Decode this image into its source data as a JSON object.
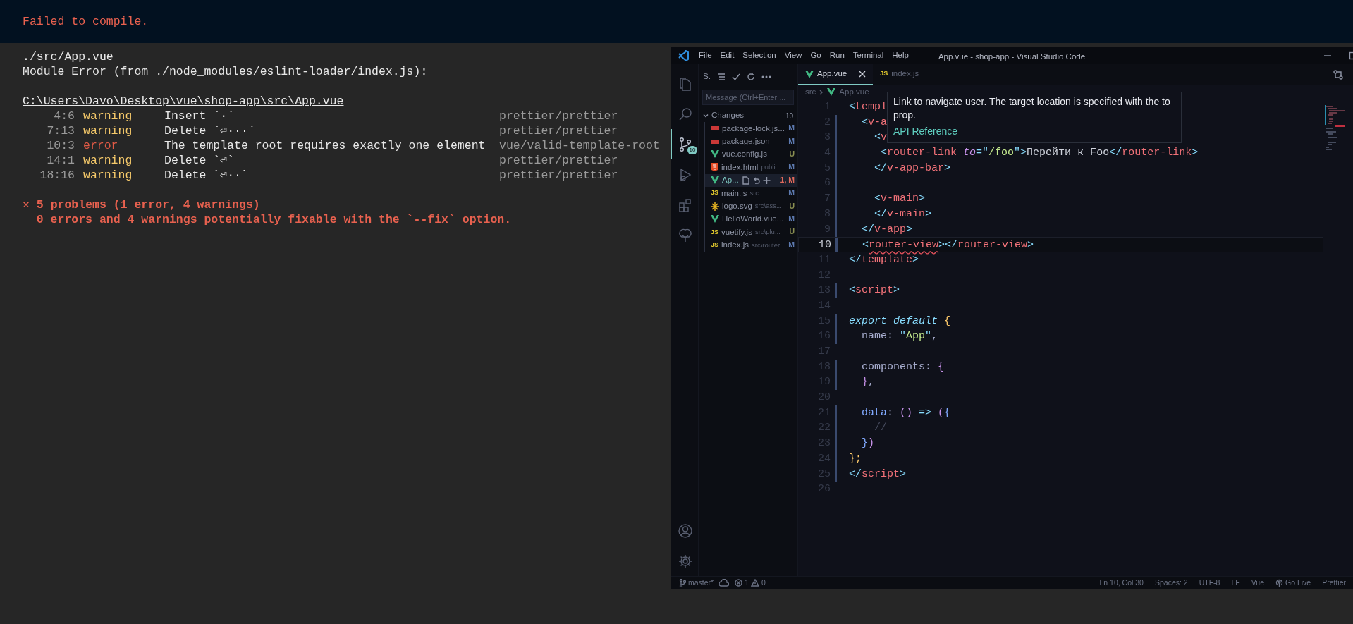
{
  "terminal": {
    "banner": "Failed to compile.",
    "file": "./src/App.vue",
    "module_error": "Module Error (from ./node_modules/eslint-loader/index.js):",
    "path": "C:\\Users\\Davo\\Desktop\\vue\\shop-app\\src\\App.vue",
    "problems": [
      {
        "location": "4:6",
        "severity": "warning",
        "kind": "warning",
        "message": "Insert `·`",
        "rule": "prettier/prettier"
      },
      {
        "location": "7:13",
        "severity": "warning",
        "kind": "warning",
        "message": "Delete `⏎···`",
        "rule": "prettier/prettier"
      },
      {
        "location": "10:3",
        "severity": "error",
        "kind": "error",
        "message": "The template root requires exactly one element",
        "rule": "vue/valid-template-root"
      },
      {
        "location": "14:1",
        "severity": "warning",
        "kind": "warning",
        "message": "Delete `⏎`",
        "rule": "prettier/prettier"
      },
      {
        "location": "18:16",
        "severity": "warning",
        "kind": "warning",
        "message": "Delete `⏎··`",
        "rule": "prettier/prettier"
      }
    ],
    "summary": "✕ 5 problems (1 error, 4 warnings)",
    "fixable": "0 errors and 4 warnings potentially fixable with the `--fix` option."
  },
  "vscode": {
    "window": {
      "title": "App.vue - shop-app - Visual Studio Code",
      "menu": [
        "File",
        "Edit",
        "Selection",
        "View",
        "Go",
        "Run",
        "Terminal",
        "Help"
      ]
    },
    "activity_bar": [
      {
        "kind": "files",
        "selected": false
      },
      {
        "kind": "search",
        "selected": false
      },
      {
        "kind": "source-control",
        "selected": true,
        "badge": "10"
      },
      {
        "kind": "run",
        "selected": false
      },
      {
        "kind": "extensions",
        "selected": false
      },
      {
        "kind": "tree",
        "selected": false
      }
    ],
    "activity_bar_bottom": [
      {
        "kind": "account"
      },
      {
        "kind": "settings"
      }
    ],
    "sidebar": {
      "title": "S.",
      "message_placeholder": "Message (Ctrl+Enter ...",
      "section": {
        "label": "Changes",
        "count": "10",
        "expanded": true
      },
      "files": [
        {
          "name": "package-lock.js...",
          "kind": "npm",
          "status": "M",
          "color": "#5d7ab0",
          "selected": false
        },
        {
          "name": "package.json",
          "kind": "npm",
          "status": "M",
          "color": "#5d7ab0",
          "selected": false
        },
        {
          "name": "vue.config.js",
          "kind": "vue",
          "status": "U",
          "color": "#8a8f52",
          "selected": false
        },
        {
          "name": "index.html",
          "path": "public",
          "kind": "html",
          "status": "M",
          "color": "#5d7ab0",
          "selected": false
        },
        {
          "name": "Ap...",
          "kind": "vue",
          "status": "1, M",
          "color": "#e0695b",
          "selected": true
        },
        {
          "name": "main.js",
          "path": "src",
          "kind": "js",
          "badge": "JS",
          "status": "M",
          "color": "#5d7ab0",
          "selected": false
        },
        {
          "name": "logo.svg",
          "path": "src\\ass...",
          "kind": "svg",
          "status": "U",
          "color": "#8a8f52",
          "selected": false
        },
        {
          "name": "HelloWorld.vue...",
          "kind": "vue",
          "status": "M",
          "color": "#5d7ab0",
          "selected": false
        },
        {
          "name": "vuetify.js",
          "path": "src\\plu...",
          "kind": "js",
          "badge": "JS",
          "status": "U",
          "color": "#8a8f52",
          "selected": false
        },
        {
          "name": "index.js",
          "path": "src\\router",
          "kind": "js",
          "badge": "JS",
          "status": "M",
          "color": "#5d7ab0",
          "selected": false
        }
      ]
    },
    "tabs": [
      {
        "label": "App.vue",
        "kind": "vue",
        "selected": true
      },
      {
        "label": "index.js",
        "kind": "js",
        "badge": "JS",
        "selected": false
      }
    ],
    "breadcrumbs": [
      {
        "label": "src",
        "kind": "none"
      },
      {
        "label": "App.vue",
        "kind": "vue"
      }
    ],
    "hover": {
      "text": "Link to navigate user. The target location is specified with the to prop.",
      "link": "API Reference"
    },
    "code": [
      {
        "number": "1",
        "modified": false,
        "current": false,
        "tokens": [
          {
            "text": "<",
            "kind": "punct"
          },
          {
            "text": "templ",
            "kind": "tag"
          }
        ]
      },
      {
        "number": "2",
        "modified": true,
        "current": false,
        "tokens": [
          {
            "text": "  <",
            "kind": "punct"
          },
          {
            "text": "v-a",
            "kind": "tag"
          }
        ]
      },
      {
        "number": "3",
        "modified": true,
        "current": false,
        "tokens": [
          {
            "text": "    <",
            "kind": "punct"
          },
          {
            "text": "v",
            "kind": "tag"
          }
        ]
      },
      {
        "number": "4",
        "modified": true,
        "current": false,
        "tokens": [
          {
            "text": "     <",
            "kind": "punct"
          },
          {
            "text": "router-link",
            "kind": "tag"
          },
          {
            "text": " to",
            "kind": "attr"
          },
          {
            "text": "=\"",
            "kind": "punct"
          },
          {
            "text": "/foo",
            "kind": "string"
          },
          {
            "text": "\">",
            "kind": "punct"
          },
          {
            "text": "Перейти к Foo",
            "kind": "text"
          },
          {
            "text": "</",
            "kind": "punct"
          },
          {
            "text": "router-link",
            "kind": "tag"
          },
          {
            "text": ">",
            "kind": "punct"
          }
        ]
      },
      {
        "number": "5",
        "modified": true,
        "current": false,
        "tokens": [
          {
            "text": "    </",
            "kind": "punct"
          },
          {
            "text": "v-app-bar",
            "kind": "tag"
          },
          {
            "text": ">",
            "kind": "punct"
          }
        ]
      },
      {
        "number": "6",
        "modified": true,
        "current": false
      },
      {
        "number": "7",
        "modified": true,
        "current": false,
        "tokens": [
          {
            "text": "    <",
            "kind": "punct"
          },
          {
            "text": "v-main",
            "kind": "tag"
          },
          {
            "text": ">",
            "kind": "punct"
          }
        ]
      },
      {
        "number": "8",
        "modified": true,
        "current": false,
        "tokens": [
          {
            "text": "    </",
            "kind": "punct"
          },
          {
            "text": "v-main",
            "kind": "tag"
          },
          {
            "text": ">",
            "kind": "punct"
          }
        ]
      },
      {
        "number": "9",
        "modified": true,
        "current": false,
        "tokens": [
          {
            "text": "  </",
            "kind": "punct"
          },
          {
            "text": "v-app",
            "kind": "tag"
          },
          {
            "text": ">",
            "kind": "punct"
          }
        ]
      },
      {
        "number": "10",
        "modified": true,
        "current": true,
        "tokens": [
          {
            "text": "  <",
            "kind": "punct"
          },
          {
            "text": "router-view",
            "kind": "tag-error"
          },
          {
            "text": "></",
            "kind": "punct"
          },
          {
            "text": "router-view",
            "kind": "tag"
          },
          {
            "text": ">",
            "kind": "punct"
          }
        ]
      },
      {
        "number": "11",
        "modified": false,
        "current": false,
        "tokens": [
          {
            "text": "</",
            "kind": "punct"
          },
          {
            "text": "template",
            "kind": "tag"
          },
          {
            "text": ">",
            "kind": "punct"
          }
        ]
      },
      {
        "number": "12",
        "modified": false,
        "current": false
      },
      {
        "number": "13",
        "modified": true,
        "current": false,
        "tokens": [
          {
            "text": "<",
            "kind": "punct"
          },
          {
            "text": "script",
            "kind": "tag"
          },
          {
            "text": ">",
            "kind": "punct"
          }
        ]
      },
      {
        "number": "14",
        "modified": false,
        "current": false
      },
      {
        "number": "15",
        "modified": true,
        "current": false,
        "tokens": [
          {
            "text": "export default ",
            "kind": "keyword"
          },
          {
            "text": "{",
            "kind": "brace"
          }
        ]
      },
      {
        "number": "16",
        "modified": true,
        "current": false,
        "tokens": [
          {
            "text": "  name: ",
            "kind": "prop"
          },
          {
            "text": "\"",
            "kind": "punct"
          },
          {
            "text": "App",
            "kind": "string"
          },
          {
            "text": "\"",
            "kind": "punct"
          },
          {
            "text": ",",
            "kind": "prop"
          }
        ]
      },
      {
        "number": "17",
        "modified": false,
        "current": false
      },
      {
        "number": "18",
        "modified": true,
        "current": false,
        "tokens": [
          {
            "text": "  components: ",
            "kind": "prop"
          },
          {
            "text": "{",
            "kind": "brace2"
          }
        ]
      },
      {
        "number": "19",
        "modified": true,
        "current": false,
        "tokens": [
          {
            "text": "  }",
            "kind": "brace2"
          },
          {
            "text": ",",
            "kind": "prop"
          }
        ]
      },
      {
        "number": "20",
        "modified": false,
        "current": false
      },
      {
        "number": "21",
        "modified": true,
        "current": false,
        "tokens": [
          {
            "text": "  data",
            "kind": "func"
          },
          {
            "text": ": ",
            "kind": "prop"
          },
          {
            "text": "()",
            "kind": "brace2"
          },
          {
            "text": " => ",
            "kind": "punct"
          },
          {
            "text": "(",
            "kind": "brace2"
          },
          {
            "text": "{",
            "kind": "func"
          }
        ]
      },
      {
        "number": "22",
        "modified": true,
        "current": false,
        "tokens": [
          {
            "text": "    //",
            "kind": "comment"
          }
        ]
      },
      {
        "number": "23",
        "modified": true,
        "current": false,
        "tokens": [
          {
            "text": "  }",
            "kind": "func"
          },
          {
            "text": ")",
            "kind": "brace2"
          }
        ]
      },
      {
        "number": "24",
        "modified": true,
        "current": false,
        "tokens": [
          {
            "text": "};",
            "kind": "brace"
          }
        ]
      },
      {
        "number": "25",
        "modified": true,
        "current": false,
        "tokens": [
          {
            "text": "</",
            "kind": "punct"
          },
          {
            "text": "script",
            "kind": "tag"
          },
          {
            "text": ">",
            "kind": "punct"
          }
        ]
      },
      {
        "number": "26",
        "modified": false,
        "current": false
      }
    ],
    "status_bar": {
      "branch": "master*",
      "errors": "1",
      "warnings": "0",
      "right": [
        {
          "text": "Ln 10, Col 30",
          "kind": "plain"
        },
        {
          "text": "Spaces: 2",
          "kind": "plain"
        },
        {
          "text": "UTF-8",
          "kind": "plain"
        },
        {
          "text": "LF",
          "kind": "plain"
        },
        {
          "text": "Vue",
          "kind": "plain"
        },
        {
          "text": "Go Live",
          "kind": "live"
        },
        {
          "text": "Prettier",
          "kind": "plain"
        }
      ]
    }
  }
}
